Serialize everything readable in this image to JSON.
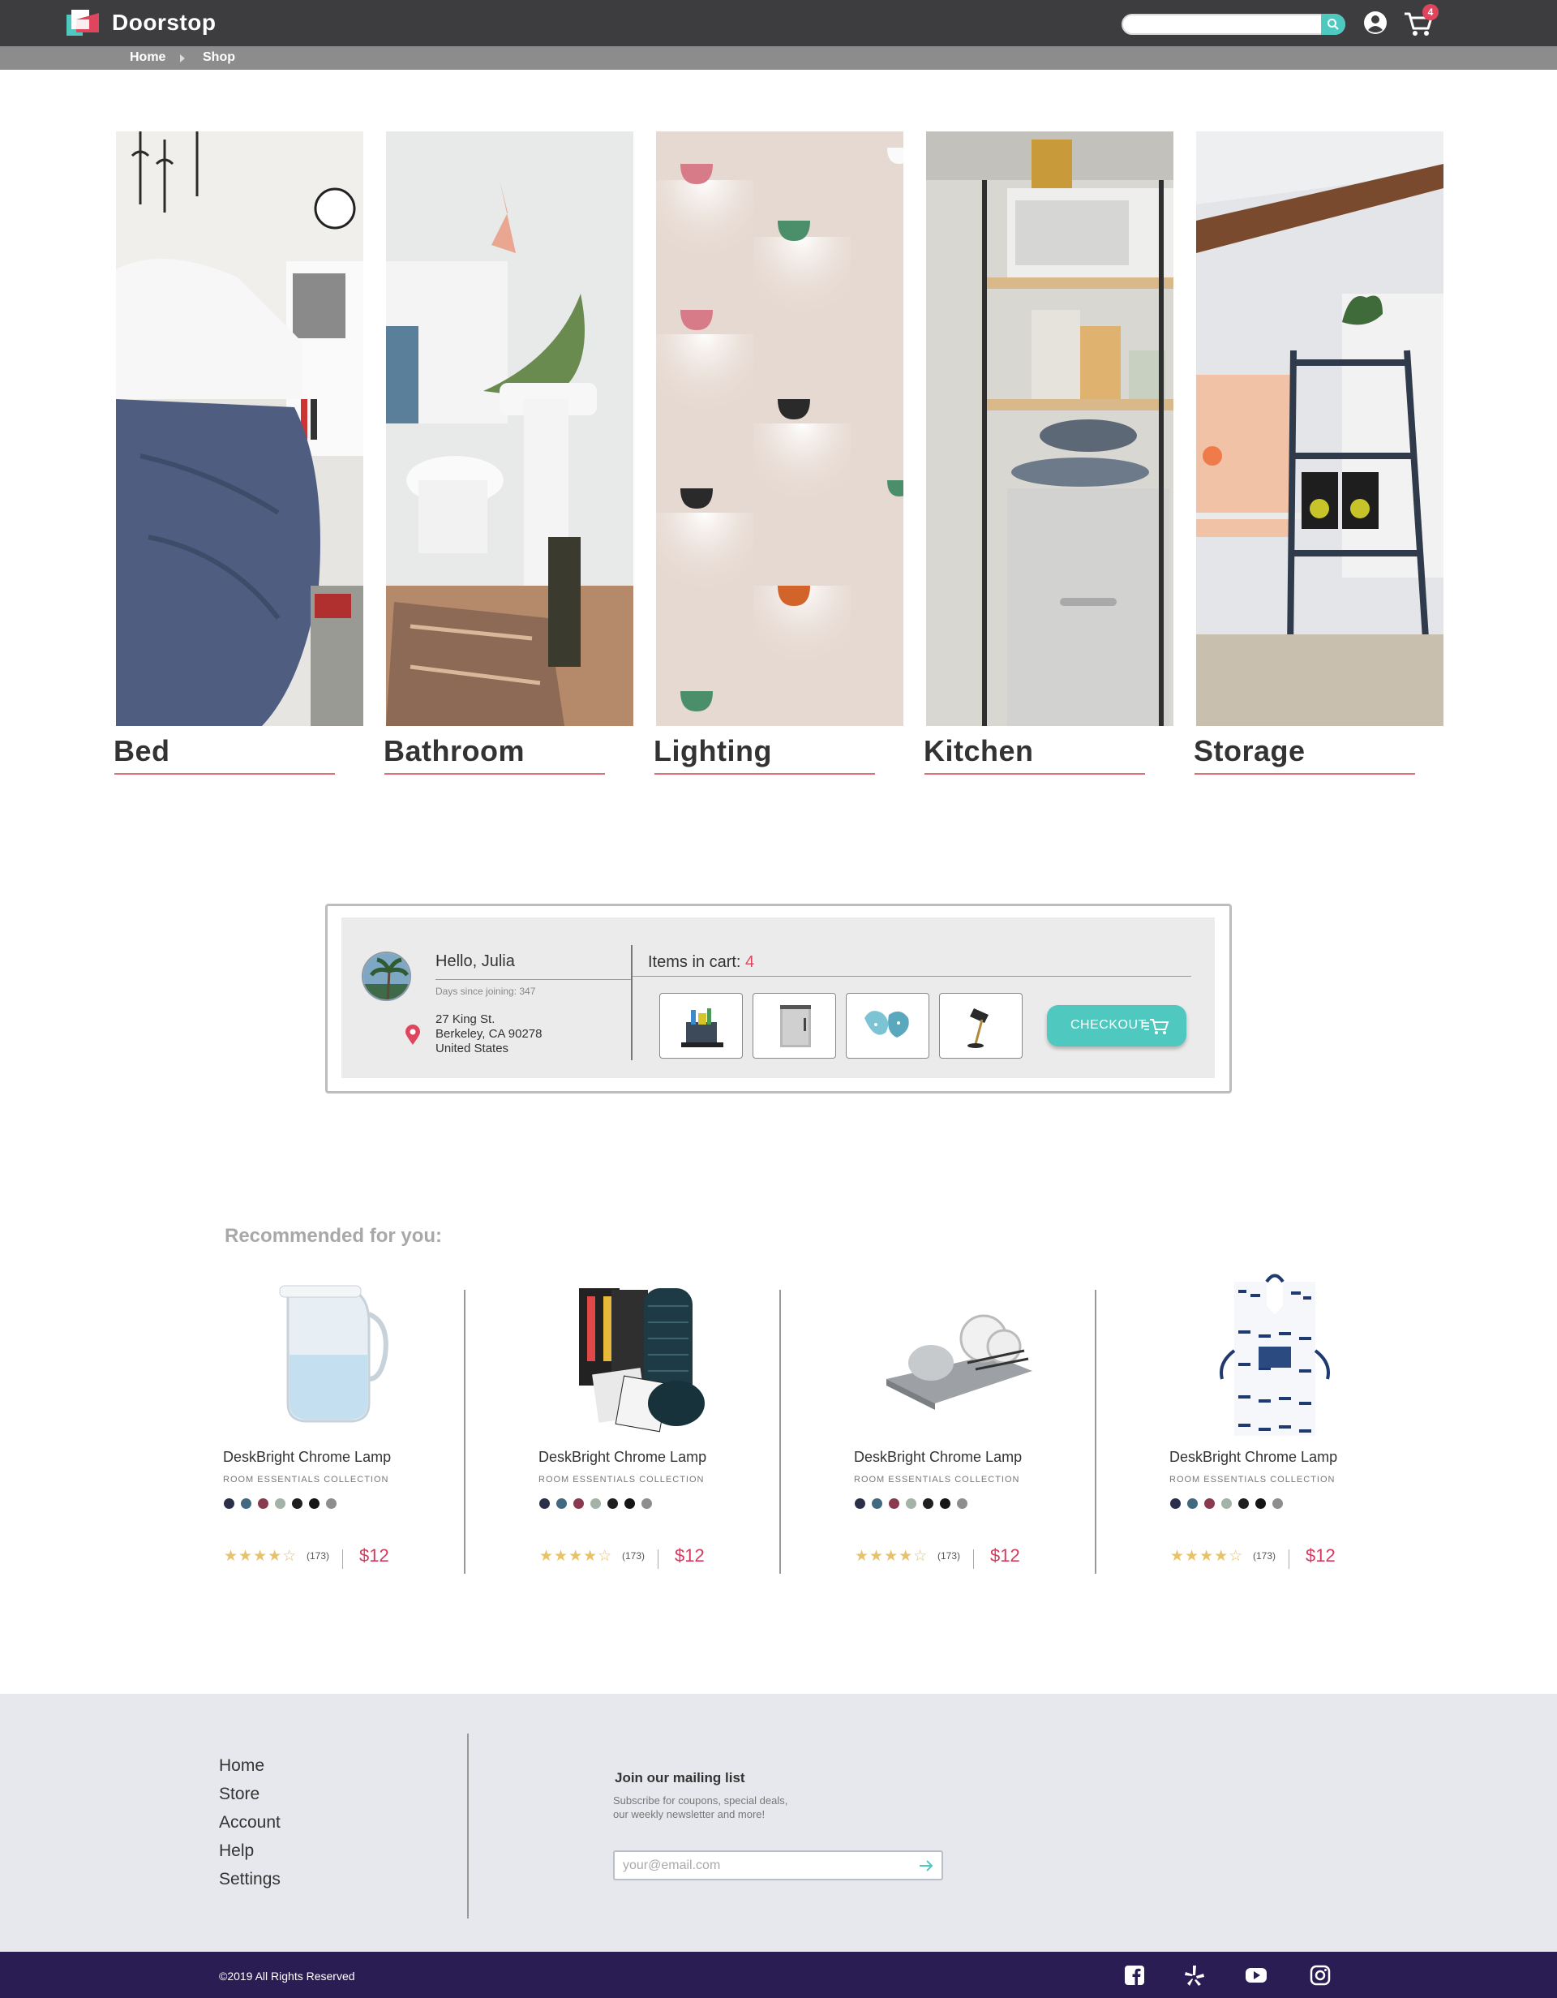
{
  "header": {
    "brand": "Doorstop",
    "cart_count": "4",
    "colors": {
      "bar": "#3d3d3f",
      "accent": "#4fc8bf",
      "badge": "#e0455e"
    }
  },
  "breadcrumb": {
    "items": [
      "Home",
      "Shop"
    ]
  },
  "categories": [
    {
      "label": "Bed"
    },
    {
      "label": "Bathroom"
    },
    {
      "label": "Lighting"
    },
    {
      "label": "Kitchen"
    },
    {
      "label": "Storage"
    }
  ],
  "account": {
    "greeting": "Hello, Julia",
    "days_joined": "Days since joining: 347",
    "address_line1": "27 King St.",
    "address_line2": "Berkeley, CA 90278",
    "address_line3": "United States",
    "cart_label": "Items in cart: ",
    "cart_count": "4",
    "cart_items": [
      "caddy-icon",
      "fridge-icon",
      "mitts-icon",
      "lamp-icon"
    ],
    "checkout_label": "CHECKOUT"
  },
  "recommended": {
    "title": "Recommended for you:",
    "products": [
      {
        "name": "DeskBright Chrome Lamp",
        "collection": "ROOM ESSENTIALS COLLECTION",
        "rating": 3.5,
        "reviews": "(173)",
        "price": "$12"
      },
      {
        "name": "DeskBright Chrome Lamp",
        "collection": "ROOM ESSENTIALS COLLECTION",
        "rating": 3.5,
        "reviews": "(173)",
        "price": "$12"
      },
      {
        "name": "DeskBright Chrome Lamp",
        "collection": "ROOM ESSENTIALS COLLECTION",
        "rating": 3.5,
        "reviews": "(173)",
        "price": "$12"
      },
      {
        "name": "DeskBright Chrome Lamp",
        "collection": "ROOM ESSENTIALS COLLECTION",
        "rating": 3.5,
        "reviews": "(173)",
        "price": "$12"
      }
    ],
    "swatch_colors": [
      "#2b2f4a",
      "#41697f",
      "#8a3a4f",
      "#a3b3a8",
      "#1f1f1f",
      "#151515",
      "#8e8e8e"
    ],
    "stars": "★★★★☆"
  },
  "footer": {
    "links": [
      "Home",
      "Store",
      "Account",
      "Help",
      "Settings"
    ],
    "mailing_title": "Join our mailing list",
    "mailing_sub1": "Subscribe for coupons, special deals,",
    "mailing_sub2": "our weekly newsletter and more!",
    "email_placeholder": "your@email.com",
    "copyright": "©2019 All Rights Reserved",
    "social": [
      "facebook-icon",
      "yelp-icon",
      "youtube-icon",
      "instagram-icon"
    ]
  }
}
